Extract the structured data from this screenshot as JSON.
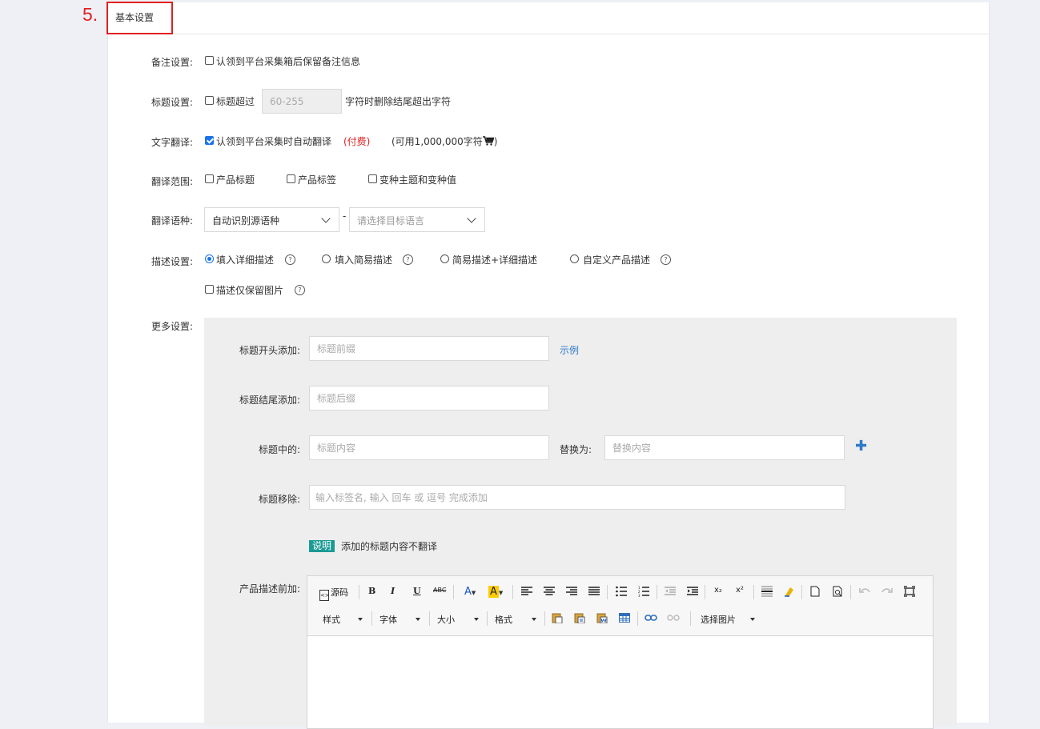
{
  "step_number": "5.",
  "panel": {
    "title": "基本设置"
  },
  "remark": {
    "label": "备注设置:",
    "option": "认领到平台采集箱后保留备注信息",
    "checked": false
  },
  "title_setting": {
    "label": "标题设置:",
    "prefix": "标题超过",
    "input_placeholder": "60-255",
    "suffix": "字符时删除结尾超出字符",
    "checked": false
  },
  "translate": {
    "label": "文字翻译:",
    "option": "认领到平台采集时自动翻译",
    "paid": "(付费)",
    "available_prefix": "(可用1,000,000字符",
    "available_suffix": ")",
    "checked": true,
    "cart_icon": "cart-icon"
  },
  "translate_scope": {
    "label": "翻译范围:",
    "options": [
      "产品标题",
      "产品标签",
      "变种主题和变种值"
    ]
  },
  "translate_lang": {
    "label": "翻译语种:",
    "source": "自动识别源语种",
    "dash": "-",
    "target_placeholder": "请选择目标语言"
  },
  "description": {
    "label": "描述设置:",
    "options": [
      "填入详细描述",
      "填入简易描述",
      "简易描述+详细描述",
      "自定义产品描述"
    ],
    "selected_index": 0,
    "image_only": "描述仅保留图片"
  },
  "more": {
    "label": "更多设置:",
    "title_prefix": {
      "label": "标题开头添加:",
      "placeholder": "标题前缀",
      "example": "示例"
    },
    "title_suffix": {
      "label": "标题结尾添加:",
      "placeholder": "标题后缀"
    },
    "title_replace": {
      "label": "标题中的:",
      "placeholder": "标题内容",
      "replace_label": "替换为:",
      "replace_placeholder": "替换内容",
      "add_icon": "plus-icon"
    },
    "title_remove": {
      "label": "标题移除:",
      "placeholder": "输入标签名, 输入 回车 或 逗号 完成添加"
    },
    "note": {
      "badge": "说明",
      "text": "添加的标题内容不翻译"
    },
    "desc_prepend": {
      "label": "产品描述前加:",
      "toolbar": {
        "source": "源码",
        "bold": "B",
        "italic": "I",
        "underline": "U",
        "strike": "ABC",
        "font_color": "A",
        "bg_color": "A",
        "sub": "x₂",
        "sup": "x²",
        "dropdowns": [
          "样式",
          "字体",
          "大小",
          "格式"
        ],
        "select_image": "选择图片"
      }
    }
  },
  "colors": {
    "accent": "#1a73e8",
    "highlight_red": "#e02020",
    "link": "#2f7ac8",
    "badge": "#1a9a94"
  }
}
